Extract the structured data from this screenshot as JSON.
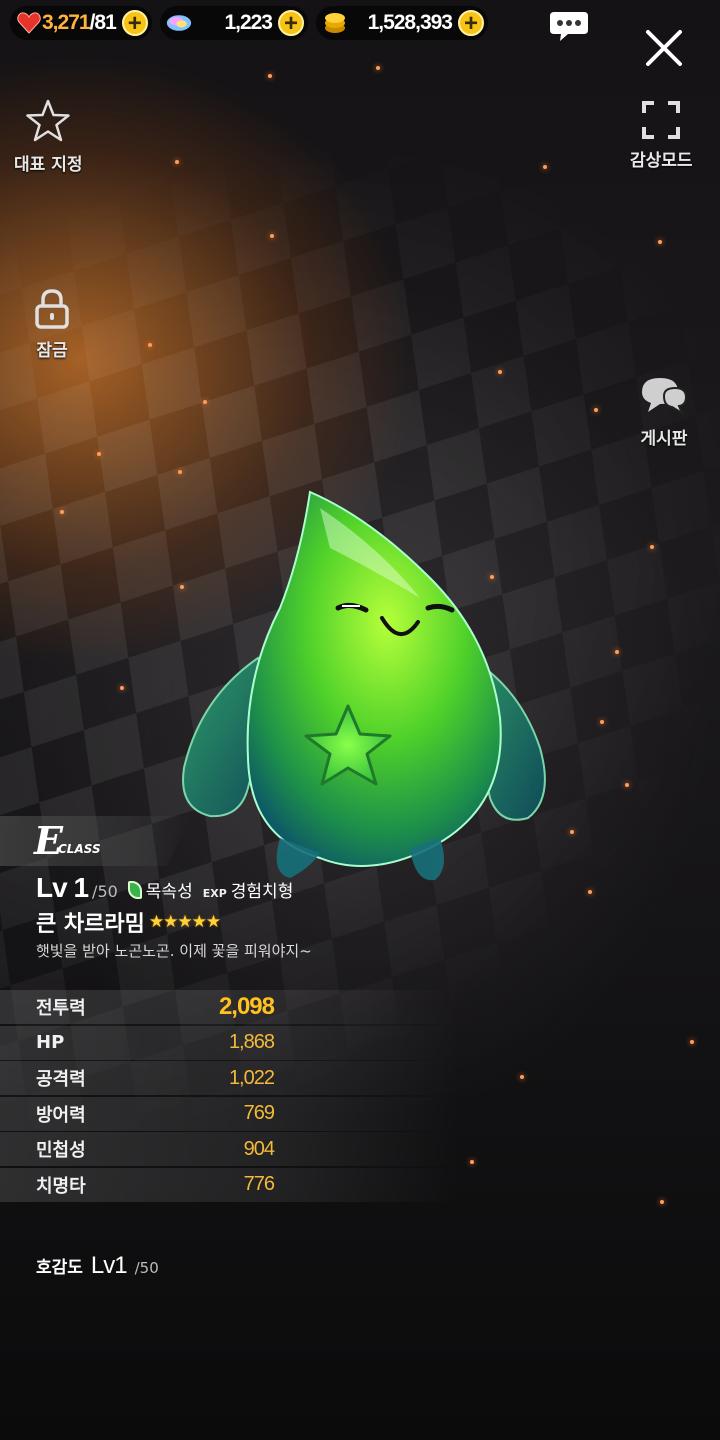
{
  "resources": {
    "stamina": {
      "value": "3,271",
      "max": "81",
      "icon": "heart-icon"
    },
    "gems": {
      "value": "1,223",
      "icon": "gem-icon"
    },
    "gold": {
      "value": "1,528,393",
      "icon": "gold-coin-icon"
    }
  },
  "top_right": {
    "chat_icon": "chat-bubble-icon",
    "close_icon": "close-icon"
  },
  "side_buttons": {
    "representative": "대표 지정",
    "lock": "잠금",
    "view_mode": "감상모드",
    "board": "게시판"
  },
  "character": {
    "class_letter": "E",
    "class_word": "CLASS",
    "level_prefix": "Lv",
    "level": "1",
    "level_max": "/50",
    "attribute": "목속성",
    "exp_tag": "EXP",
    "growth_type": "경험치형",
    "name": "큰 차르라밈",
    "stars": "★★★★★",
    "star_count": 5,
    "description": "햇빛을 받아 노곤노곤. 이제 꽃을 피워야지~"
  },
  "stats": [
    {
      "label": "전투력",
      "value": "2,098"
    },
    {
      "label": "HP",
      "value": "1,868"
    },
    {
      "label": "공격력",
      "value": "1,022"
    },
    {
      "label": "방어력",
      "value": "769"
    },
    {
      "label": "민첩성",
      "value": "904"
    },
    {
      "label": "치명타",
      "value": "776"
    }
  ],
  "affinity": {
    "label": "호감도",
    "level": "Lv1",
    "max": "/50"
  },
  "colors": {
    "accent": "#f6c316",
    "stat_value": "#f3b93a",
    "slime": "#4fd12a"
  }
}
